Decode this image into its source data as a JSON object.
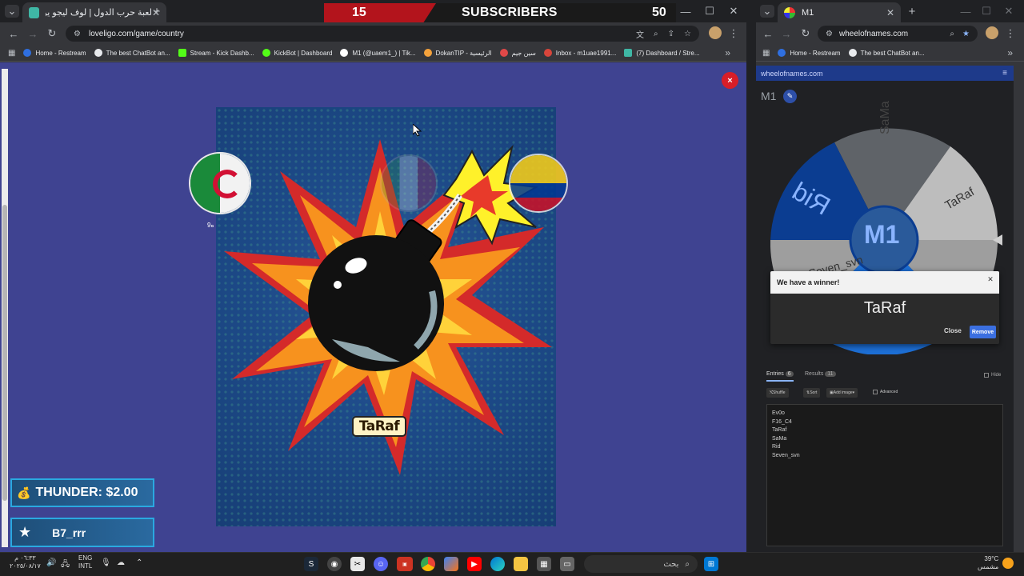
{
  "left_browser": {
    "tab_title": "لعبة حرب الدول | لوف ليجو يوفر",
    "new_tab": "+",
    "address": "loveligo.com/game/country",
    "bookmarks": [
      {
        "label": "Home - Restream",
        "color": "#2f6fe0"
      },
      {
        "label": "The best ChatBot an...",
        "color": "#e8eaed"
      },
      {
        "label": "Stream - Kick Dashb...",
        "color": "#53fc18"
      },
      {
        "label": "KickBot | Dashboard",
        "color": "#53fc18"
      },
      {
        "label": "M1 (@uaem1_) | Tik...",
        "color": "#ffffff"
      },
      {
        "label": "DokanTIP - الرئيسية",
        "color": "#f4a23c"
      },
      {
        "label": "سين جيم",
        "color": "#e04848"
      },
      {
        "label": "Inbox - m1uae1991...",
        "color": "#d8453b"
      },
      {
        "label": "(7) Dashboard / Stre...",
        "color": "#3fb7a5"
      }
    ],
    "more_bookmarks": "»"
  },
  "overlay": {
    "sub_count_left": "15",
    "sub_label": "SUBSCRIBERS",
    "sub_count_right": "50",
    "thunder_alert": "THUNDER: $2.00",
    "star_alert": "B7_rrr"
  },
  "game": {
    "player_name": "TaRaf",
    "flag_label": "ه9",
    "close_symbol": "×"
  },
  "right_browser": {
    "tab_title": "M1",
    "address": "wheelofnames.com",
    "bookmarks": [
      {
        "label": "Home - Restream",
        "color": "#2f6fe0"
      },
      {
        "label": "The best ChatBot an...",
        "color": "#e8eaed"
      }
    ],
    "site_name": "wheelofnames.com",
    "wheel_title": "M1",
    "wheel_labels": [
      "SaMa",
      "TaRaf",
      "Rid",
      "Seven_svn",
      "M1"
    ],
    "modal": {
      "heading": "We have a winner!",
      "winner": "TaRaf",
      "close_label": "Close",
      "remove_label": "Remove"
    },
    "tabs": {
      "entries": "Entries",
      "entries_count": "6",
      "results": "Results",
      "results_count": "11",
      "hide": "Hide"
    },
    "tools": {
      "shuffle": "Shuffle",
      "sort": "Sort",
      "add_image": "Add image",
      "advanced": "Advanced"
    },
    "entries": [
      "Ev0o",
      "F16_C4",
      "TaRaf",
      "SaMa",
      "Rid",
      "Seven_svn"
    ]
  },
  "taskbar": {
    "time": "٠٦:٣٣ م",
    "date": "٢٠٢٥/٠٨/١٧",
    "lang1": "ENG",
    "lang2": "INTL",
    "search_placeholder": "بحث",
    "temperature": "39°C",
    "weather": "مشمس"
  }
}
